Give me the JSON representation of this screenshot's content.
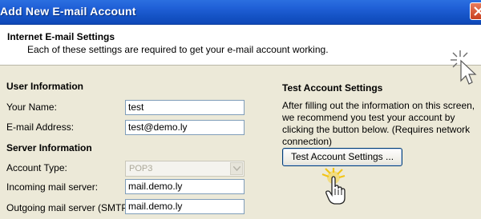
{
  "window": {
    "title": "Add New E-mail Account"
  },
  "header": {
    "title": "Internet E-mail Settings",
    "description": "Each of these settings are required to get your e-mail account working."
  },
  "user_info": {
    "heading": "User Information",
    "name_label": "Your Name:",
    "name_value": "test",
    "email_label": "E-mail Address:",
    "email_value": "test@demo.ly"
  },
  "server_info": {
    "heading": "Server Information",
    "account_type_label": "Account Type:",
    "account_type_value": "POP3",
    "incoming_label": "Incoming mail server:",
    "incoming_value": "mail.demo.ly",
    "outgoing_label": "Outgoing mail server (SMTP):",
    "outgoing_value": "mail.demo.ly"
  },
  "test_settings": {
    "heading": "Test Account Settings",
    "description": "After filling out the information on this screen, we recommend you test your account by clicking the button below. (Requires network connection)",
    "button_label": "Test Account Settings ..."
  },
  "colors": {
    "titlebar": "#1f5fd6",
    "dialog_bg": "#ece9d8",
    "field_border": "#7f9db9",
    "button_border": "#003c74"
  },
  "icons": [
    "close-icon",
    "cursor-click-icon",
    "dropdown-arrow-icon",
    "hand-pointer-icon"
  ]
}
